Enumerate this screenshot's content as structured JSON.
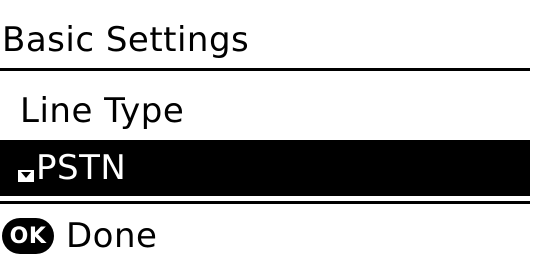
{
  "header": {
    "title": "Basic Settings"
  },
  "menu": {
    "item_label": "Line Type",
    "selected_value": "PSTN"
  },
  "footer": {
    "ok_key_label": "OK",
    "action_label": "Done"
  }
}
